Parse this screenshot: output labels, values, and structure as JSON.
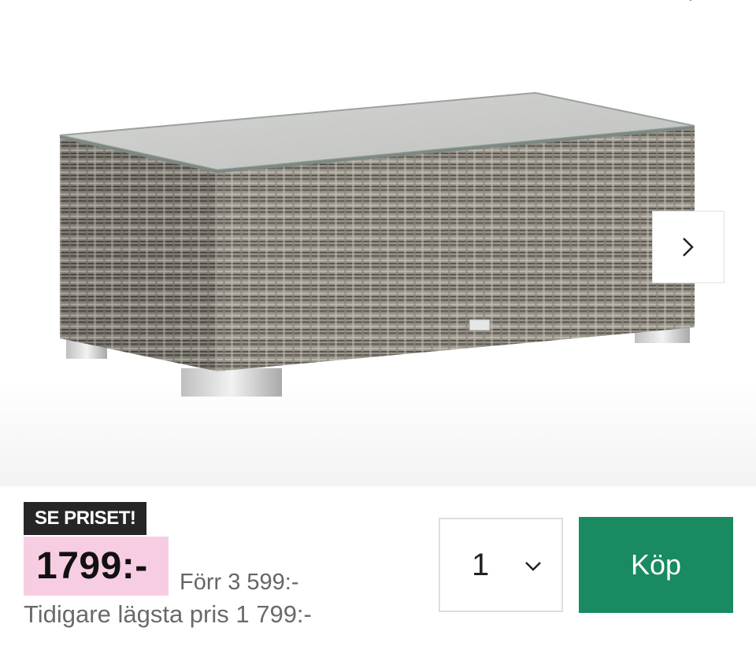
{
  "gallery": {
    "image_description_icon": "rattan-coffee-table-image",
    "next_icon": "chevron-right-icon",
    "top_icon": "chevron-down-icon"
  },
  "price_panel": {
    "badge_label": "SE PRISET!",
    "price": "1799:-",
    "previous_price": "Förr 3 599:-",
    "lowest_price": "Tidigare lägsta pris 1 799:-"
  },
  "quantity": {
    "value": "1",
    "icon": "chevron-down-icon"
  },
  "buy_button": {
    "label": "Köp"
  },
  "colors": {
    "buy_button": "#1a8a61",
    "badge_bg": "#262626",
    "price_highlight": "#f7cde3"
  }
}
